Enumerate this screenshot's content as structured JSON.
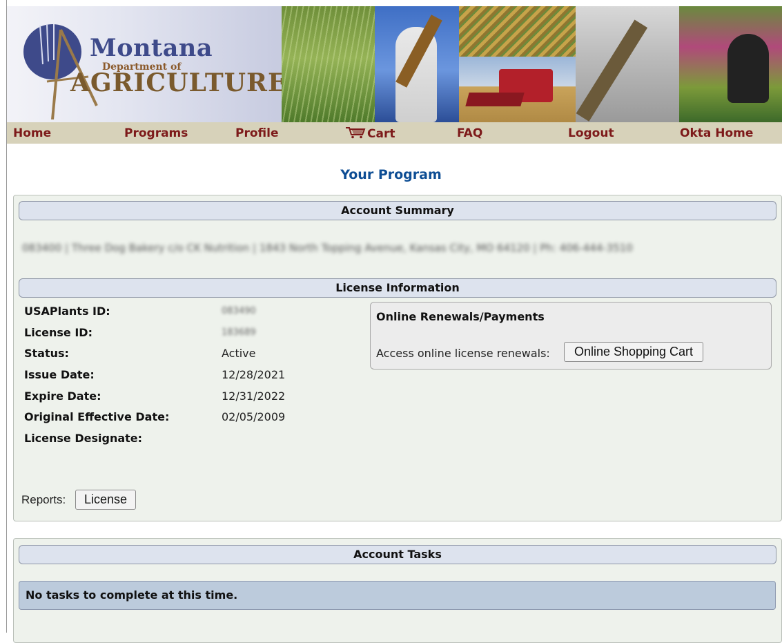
{
  "header": {
    "logo_line1": "Montana",
    "logo_line2": "Department of",
    "logo_line3": "AGRICULTURE"
  },
  "nav": {
    "home": "Home",
    "programs": "Programs",
    "profile": "Profile",
    "cart": "Cart",
    "faq": "FAQ",
    "logout": "Logout",
    "okta_home": "Okta Home"
  },
  "page_title": "Your Program",
  "account_summary": {
    "heading": "Account Summary",
    "details_redacted": "083400 | Three Dog Bakery c/o CK Nutrition | 1843 North Topping Avenue, Kansas City, MO 64120 | Ph: 406-444-3510"
  },
  "license_info": {
    "heading": "License Information",
    "fields": [
      {
        "label": "USAPlants ID:",
        "value": "083490",
        "redacted": true
      },
      {
        "label": "License ID:",
        "value": "183689",
        "redacted": true
      },
      {
        "label": "Status:",
        "value": "Active",
        "redacted": false
      },
      {
        "label": "Issue Date:",
        "value": "12/28/2021",
        "redacted": false
      },
      {
        "label": "Expire Date:",
        "value": "12/31/2022",
        "redacted": false
      },
      {
        "label": "Original Effective Date:",
        "value": "02/05/2009",
        "redacted": false
      },
      {
        "label": "License Designate:",
        "value": "",
        "redacted": false
      }
    ],
    "renewals_title": "Online Renewals/Payments",
    "renewals_text": "Access online license renewals:",
    "renewals_button": "Online Shopping Cart",
    "reports_label": "Reports:",
    "reports_button": "License"
  },
  "account_tasks": {
    "heading": "Account Tasks",
    "message": "No tasks to complete at this time."
  },
  "colors": {
    "nav_bg": "#d7d2ba",
    "nav_text": "#7d1a1a",
    "title_blue": "#0d4d94",
    "panel_bg": "#eef2ec",
    "section_bar": "#dde3ee",
    "task_bar": "#bccbdc"
  }
}
